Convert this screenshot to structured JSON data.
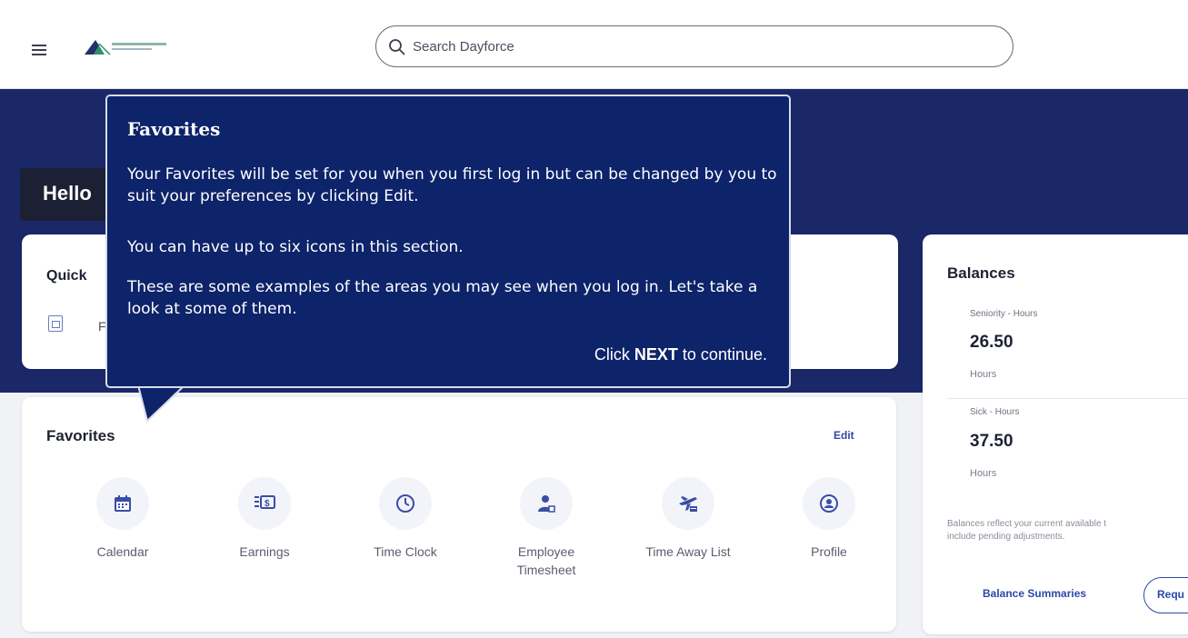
{
  "colors": {
    "navy_band": "#1a2868",
    "tooltip_bg": "#0d236a",
    "link_blue": "#2c48a8",
    "icon_blue": "#3a4da6"
  },
  "header": {
    "search_placeholder": "Search Dayforce",
    "logo_icon": "company-logo"
  },
  "hero": {
    "greeting": "Hello"
  },
  "quick": {
    "title": "Quick",
    "first_item_label": "F"
  },
  "favorites": {
    "title": "Favorites",
    "edit_label": "Edit",
    "items": [
      {
        "label": "Calendar",
        "icon": "calendar-icon"
      },
      {
        "label": "Earnings",
        "icon": "earnings-icon"
      },
      {
        "label": "Time Clock",
        "icon": "clock-icon"
      },
      {
        "label": "Employee Timesheet",
        "icon": "employee-timesheet-icon"
      },
      {
        "label": "Time Away List",
        "icon": "time-away-icon"
      },
      {
        "label": "Profile",
        "icon": "profile-icon"
      }
    ]
  },
  "balances": {
    "title": "Balances",
    "items": [
      {
        "label": "Seniority - Hours",
        "value": "26.50",
        "unit": "Hours"
      },
      {
        "label": "Sick - Hours",
        "value": "37.50",
        "unit": "Hours"
      }
    ],
    "note_line1": "Balances reflect your current available t",
    "note_line2": "include pending adjustments.",
    "summaries_link": "Balance Summaries",
    "request_button": "Requ"
  },
  "tooltip": {
    "title": "Favorites",
    "paragraph1": "Your Favorites will be set for you when you first log in but can be changed by you to suit your preferences by clicking Edit.",
    "paragraph2": "You can have up to six icons in this section.",
    "paragraph3": "These are some examples of the areas you may see when you log in. Let's take a look at some of them.",
    "next_prefix": "Click",
    "next_keyword": "NEXT",
    "next_suffix": "to continue."
  }
}
